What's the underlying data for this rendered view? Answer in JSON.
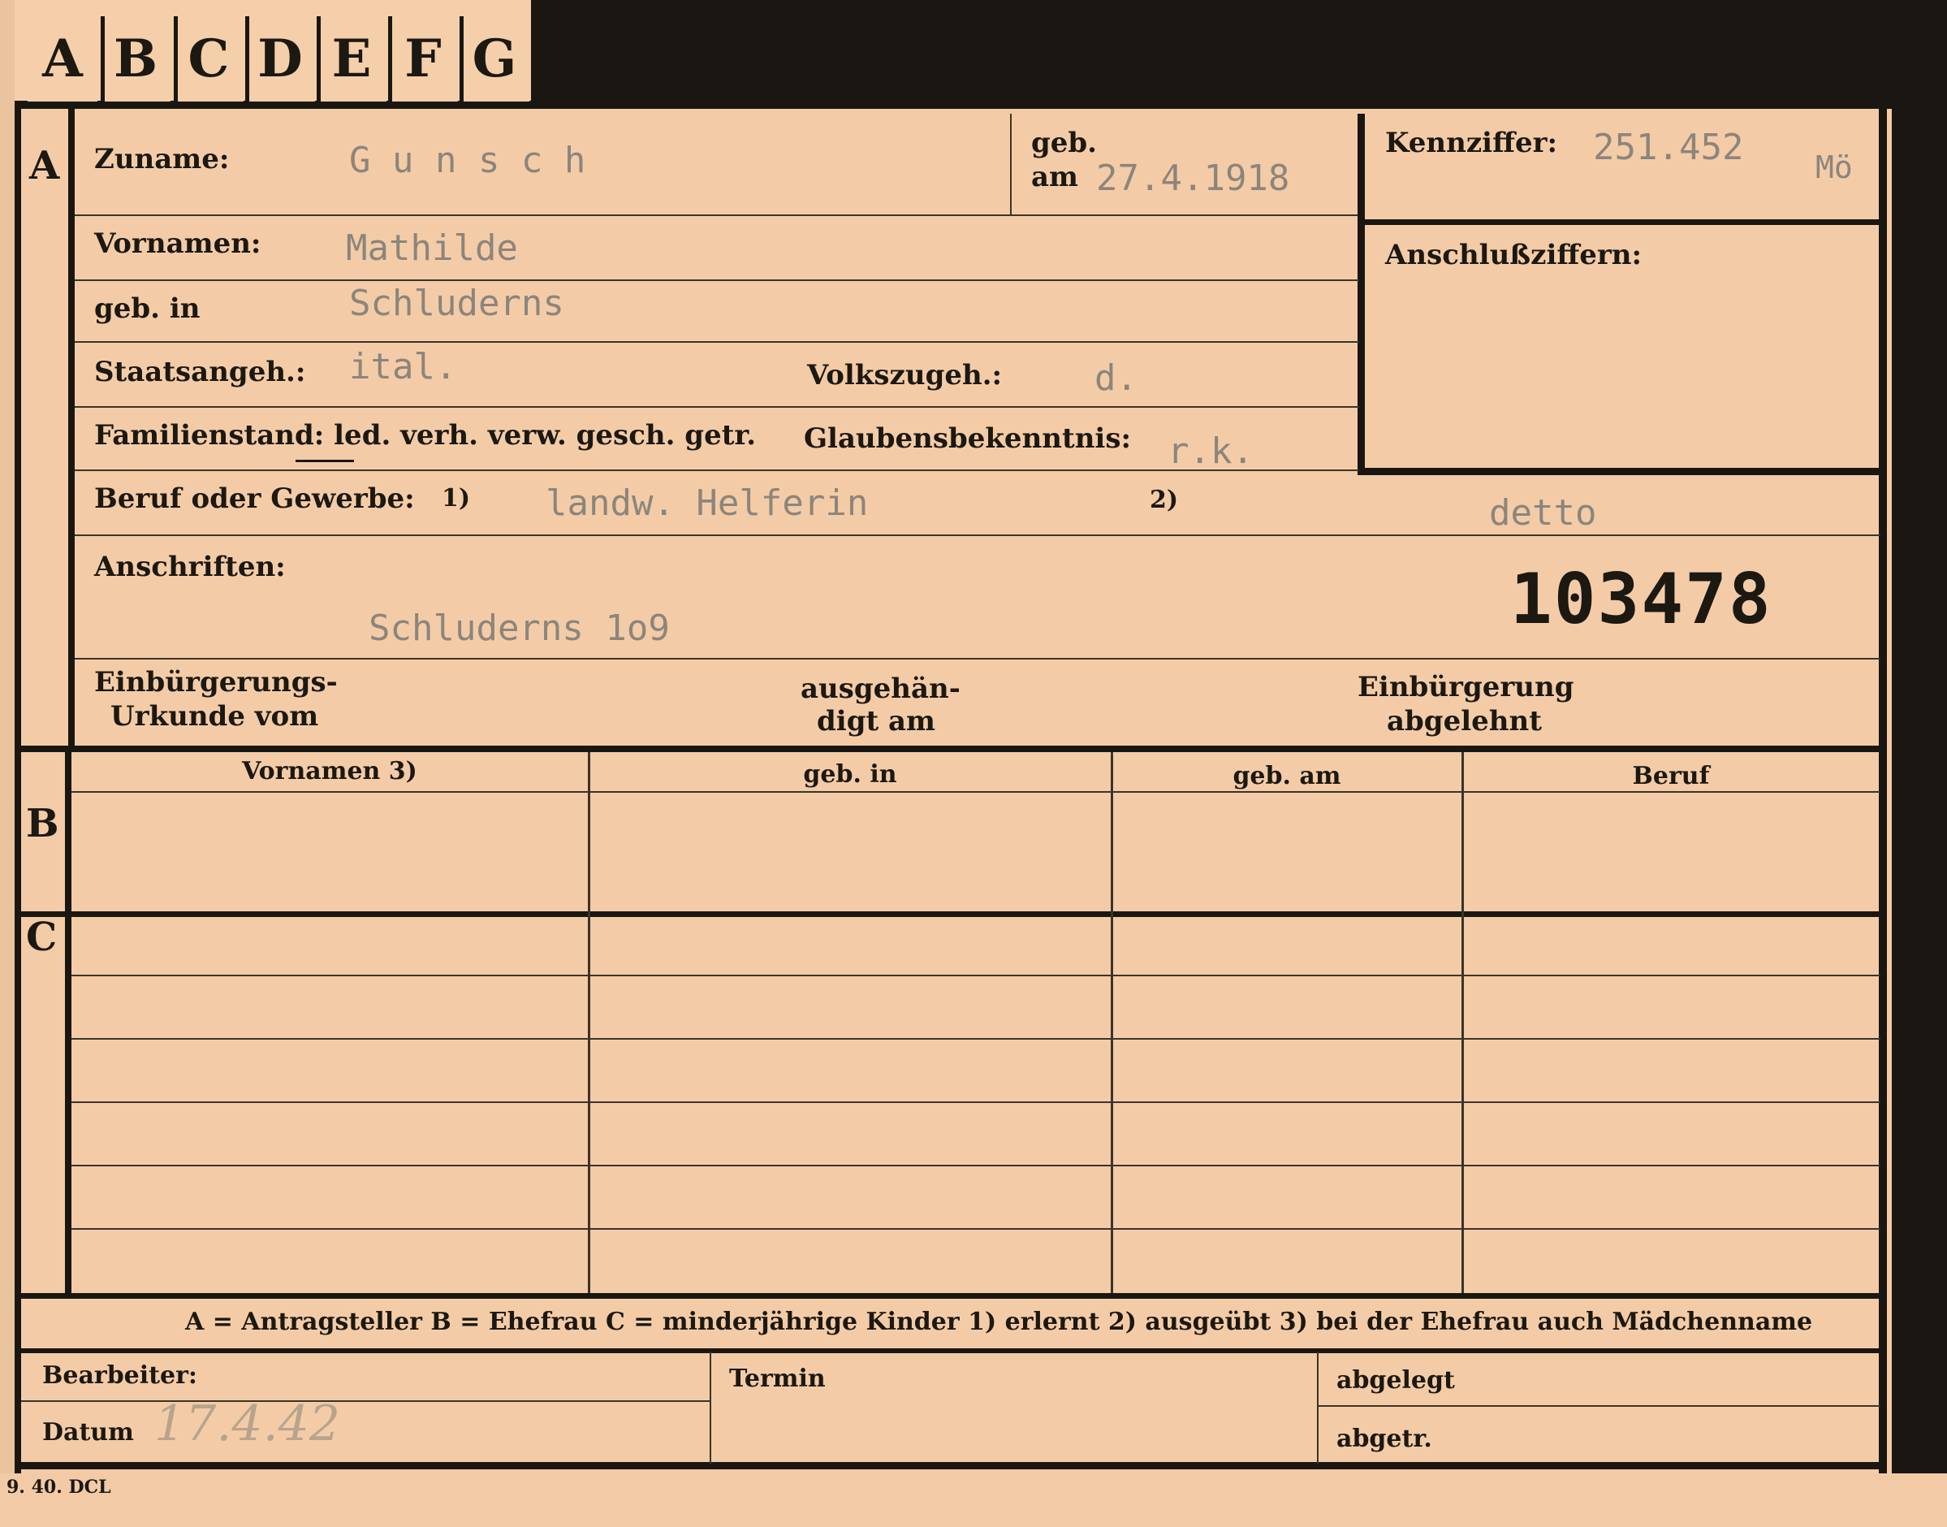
{
  "tabs": [
    "A",
    "B",
    "C",
    "D",
    "E",
    "F",
    "G"
  ],
  "sections": {
    "a": "A",
    "b": "B",
    "c": "C"
  },
  "fields": {
    "zuname_label": "Zuname:",
    "zuname_value": "G u n s c h",
    "geb_label": "geb.",
    "am_label": "am",
    "geb_am_value": "27.4.1918",
    "kennziffer_label": "Kennziffer:",
    "kennziffer_value": "251.452",
    "kennziffer_suffix": "Mö",
    "vornamen_label": "Vornamen:",
    "vornamen_value": "Mathilde",
    "gebin_label": "geb. in",
    "gebin_value": "Schluderns",
    "anschluss_label": "Anschlußziffern:",
    "staats_label": "Staatsangeh.:",
    "staats_value": "ital.",
    "volks_label": "Volkszugeh.:",
    "volks_value": "d.",
    "familien_label": "Familienstand: led. verh. verw. gesch. getr.",
    "glauben_label": "Glaubensbekenntnis:",
    "glauben_value": "r.k.",
    "beruf_label": "Beruf oder Gewerbe:",
    "beruf_mark1": "1)",
    "beruf_value1": "landw. Helferin",
    "beruf_mark2": "2)",
    "beruf_value2": "detto",
    "anschriften_label": "Anschriften:",
    "anschriften_value": "Schluderns 1o9",
    "stamp_number": "103478",
    "einb_urkunde_1": "Einbürgerungs-",
    "einb_urkunde_2": "Urkunde vom",
    "ausgehaen_1": "ausgehän-",
    "ausgehaen_2": "digt am",
    "einb_abgelehnt_1": "Einbürgerung",
    "einb_abgelehnt_2": "abgelehnt"
  },
  "table": {
    "headers": [
      "Vornamen 3)",
      "geb. in",
      "geb. am",
      "Beruf"
    ]
  },
  "legend": "A = Antragsteller   B = Ehefrau   C = minderjährige Kinder   1) erlernt   2) ausgeübt   3) bei der Ehefrau auch Mädchenname",
  "footer": {
    "bearbeiter_label": "Bearbeiter:",
    "datum_label": "Datum",
    "datum_value": "17.4.42",
    "termin_label": "Termin",
    "abgelegt_label": "abgelegt",
    "abgetr_label": "abgetr.",
    "print_code": "9. 40. DCL"
  }
}
